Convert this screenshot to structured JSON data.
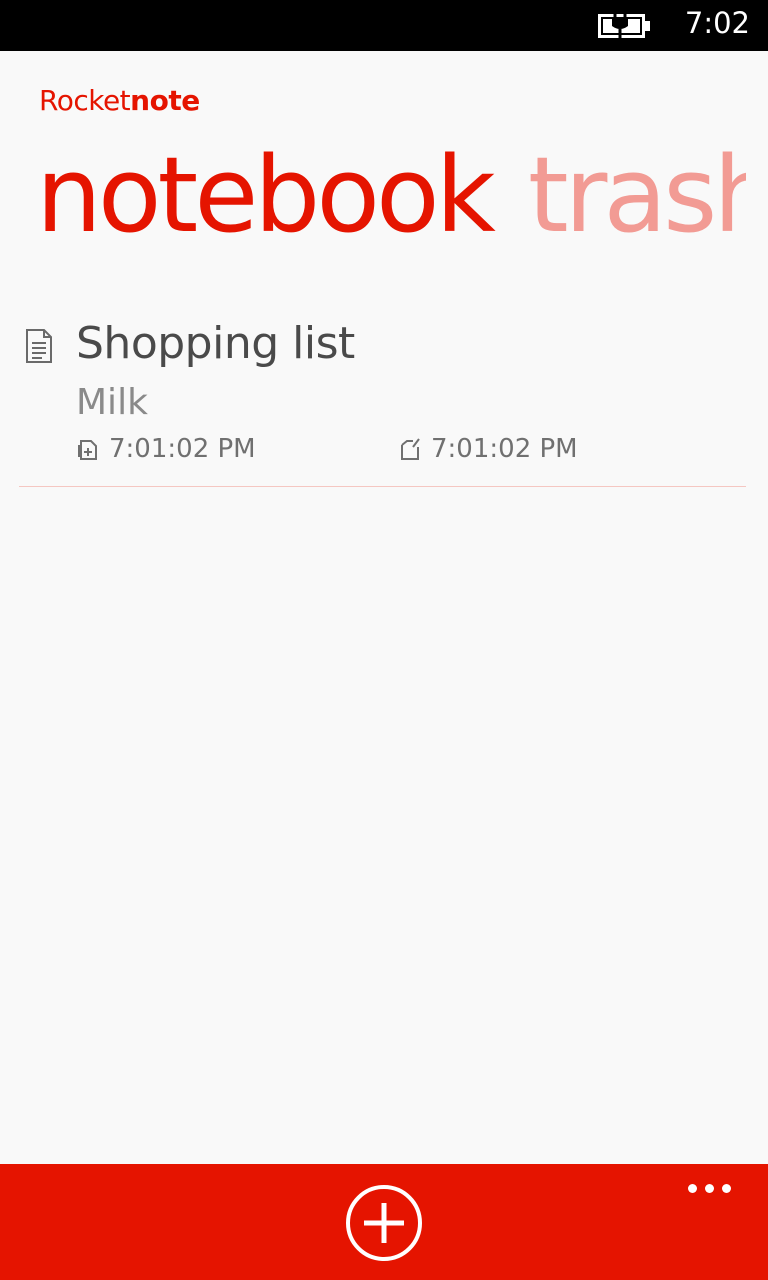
{
  "status_bar": {
    "time": "7:02",
    "battery_icon": "battery-charging-icon"
  },
  "app": {
    "title_regular": "Rocket",
    "title_bold": "note",
    "accent_color": "#e51400"
  },
  "pivot": {
    "items": [
      {
        "label": "notebook",
        "active": true
      },
      {
        "label": "trash",
        "active": false
      }
    ]
  },
  "notes": [
    {
      "icon": "document-icon",
      "title": "Shopping list",
      "preview": "Milk",
      "created_icon": "note-created-icon",
      "created": "7:01:02 PM",
      "modified_icon": "note-edited-icon",
      "modified": "7:01:02 PM"
    }
  ],
  "app_bar": {
    "add_icon": "add-circle-icon",
    "more_icon": "ellipsis-icon"
  }
}
